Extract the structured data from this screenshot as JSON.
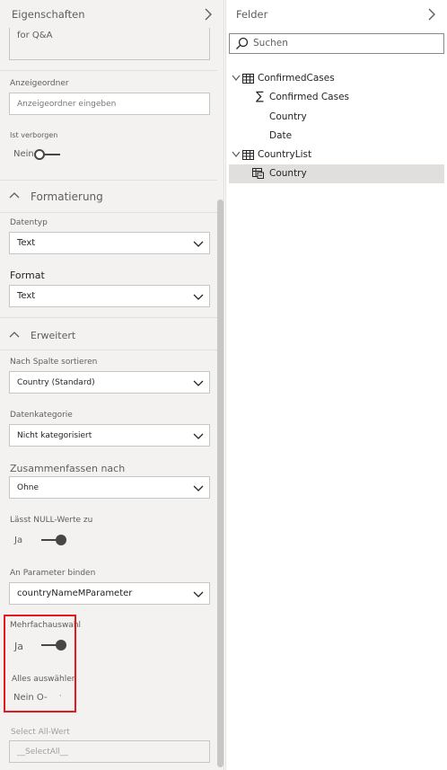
{
  "properties_pane": {
    "title": "Eigenschaften",
    "truncated_field_value": "for Q&A",
    "display_folder": {
      "label": "Anzeigeordner",
      "placeholder": "Anzeigeordner eingeben"
    },
    "hidden": {
      "label": "Ist verborgen",
      "value": "Nein"
    },
    "formatting_section": {
      "title": "Formatierung",
      "data_type": {
        "label": "Datentyp",
        "value": "Text"
      },
      "format": {
        "label": "Format",
        "value": "Text"
      }
    },
    "advanced_section": {
      "title": "Erweitert",
      "sort_by_column": {
        "label": "Nach Spalte sortieren",
        "value": "Country (Standard)"
      },
      "data_category": {
        "label": "Datenkategorie",
        "value": "Nicht kategorisiert"
      },
      "summarize_by": {
        "label": "Zusammenfassen nach",
        "value": "Ohne"
      },
      "allow_null": {
        "label": "Lässt NULL-Werte zu",
        "value": "Ja"
      },
      "bind_to_parameter": {
        "label": "An Parameter binden",
        "value": "countryNameMParameter"
      },
      "multi_select": {
        "label": "Mehrfachauswahl",
        "value": "Ja"
      },
      "select_all": {
        "label": "Alles auswählen",
        "value": "Nein O-"
      },
      "select_all_value": {
        "label": "Select All-Wert",
        "value": "__SelectAll__"
      }
    }
  },
  "fields_pane": {
    "title": "Felder",
    "search_placeholder": "Suchen",
    "tables": [
      {
        "name": "ConfirmedCases",
        "fields": [
          "Confirmed Cases",
          "Country",
          "Date"
        ]
      },
      {
        "name": "CountryList",
        "fields": [
          "Country"
        ]
      }
    ]
  },
  "colors": {
    "highlight": "#e3191f",
    "toggle": "#484644",
    "selected_row": "#e1dfdd"
  }
}
